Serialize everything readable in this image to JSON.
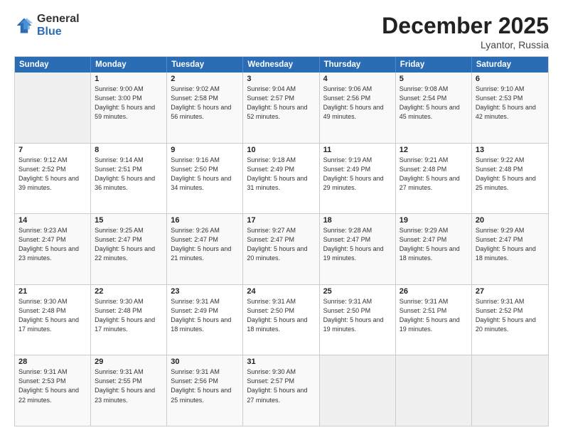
{
  "logo": {
    "general": "General",
    "blue": "Blue"
  },
  "title": {
    "month": "December 2025",
    "location": "Lyantor, Russia"
  },
  "header": {
    "days": [
      "Sunday",
      "Monday",
      "Tuesday",
      "Wednesday",
      "Thursday",
      "Friday",
      "Saturday"
    ]
  },
  "weeks": [
    [
      {
        "day": "",
        "sunrise": "",
        "sunset": "",
        "daylight": ""
      },
      {
        "day": "1",
        "sunrise": "Sunrise: 9:00 AM",
        "sunset": "Sunset: 3:00 PM",
        "daylight": "Daylight: 5 hours and 59 minutes."
      },
      {
        "day": "2",
        "sunrise": "Sunrise: 9:02 AM",
        "sunset": "Sunset: 2:58 PM",
        "daylight": "Daylight: 5 hours and 56 minutes."
      },
      {
        "day": "3",
        "sunrise": "Sunrise: 9:04 AM",
        "sunset": "Sunset: 2:57 PM",
        "daylight": "Daylight: 5 hours and 52 minutes."
      },
      {
        "day": "4",
        "sunrise": "Sunrise: 9:06 AM",
        "sunset": "Sunset: 2:56 PM",
        "daylight": "Daylight: 5 hours and 49 minutes."
      },
      {
        "day": "5",
        "sunrise": "Sunrise: 9:08 AM",
        "sunset": "Sunset: 2:54 PM",
        "daylight": "Daylight: 5 hours and 45 minutes."
      },
      {
        "day": "6",
        "sunrise": "Sunrise: 9:10 AM",
        "sunset": "Sunset: 2:53 PM",
        "daylight": "Daylight: 5 hours and 42 minutes."
      }
    ],
    [
      {
        "day": "7",
        "sunrise": "Sunrise: 9:12 AM",
        "sunset": "Sunset: 2:52 PM",
        "daylight": "Daylight: 5 hours and 39 minutes."
      },
      {
        "day": "8",
        "sunrise": "Sunrise: 9:14 AM",
        "sunset": "Sunset: 2:51 PM",
        "daylight": "Daylight: 5 hours and 36 minutes."
      },
      {
        "day": "9",
        "sunrise": "Sunrise: 9:16 AM",
        "sunset": "Sunset: 2:50 PM",
        "daylight": "Daylight: 5 hours and 34 minutes."
      },
      {
        "day": "10",
        "sunrise": "Sunrise: 9:18 AM",
        "sunset": "Sunset: 2:49 PM",
        "daylight": "Daylight: 5 hours and 31 minutes."
      },
      {
        "day": "11",
        "sunrise": "Sunrise: 9:19 AM",
        "sunset": "Sunset: 2:49 PM",
        "daylight": "Daylight: 5 hours and 29 minutes."
      },
      {
        "day": "12",
        "sunrise": "Sunrise: 9:21 AM",
        "sunset": "Sunset: 2:48 PM",
        "daylight": "Daylight: 5 hours and 27 minutes."
      },
      {
        "day": "13",
        "sunrise": "Sunrise: 9:22 AM",
        "sunset": "Sunset: 2:48 PM",
        "daylight": "Daylight: 5 hours and 25 minutes."
      }
    ],
    [
      {
        "day": "14",
        "sunrise": "Sunrise: 9:23 AM",
        "sunset": "Sunset: 2:47 PM",
        "daylight": "Daylight: 5 hours and 23 minutes."
      },
      {
        "day": "15",
        "sunrise": "Sunrise: 9:25 AM",
        "sunset": "Sunset: 2:47 PM",
        "daylight": "Daylight: 5 hours and 22 minutes."
      },
      {
        "day": "16",
        "sunrise": "Sunrise: 9:26 AM",
        "sunset": "Sunset: 2:47 PM",
        "daylight": "Daylight: 5 hours and 21 minutes."
      },
      {
        "day": "17",
        "sunrise": "Sunrise: 9:27 AM",
        "sunset": "Sunset: 2:47 PM",
        "daylight": "Daylight: 5 hours and 20 minutes."
      },
      {
        "day": "18",
        "sunrise": "Sunrise: 9:28 AM",
        "sunset": "Sunset: 2:47 PM",
        "daylight": "Daylight: 5 hours and 19 minutes."
      },
      {
        "day": "19",
        "sunrise": "Sunrise: 9:29 AM",
        "sunset": "Sunset: 2:47 PM",
        "daylight": "Daylight: 5 hours and 18 minutes."
      },
      {
        "day": "20",
        "sunrise": "Sunrise: 9:29 AM",
        "sunset": "Sunset: 2:47 PM",
        "daylight": "Daylight: 5 hours and 18 minutes."
      }
    ],
    [
      {
        "day": "21",
        "sunrise": "Sunrise: 9:30 AM",
        "sunset": "Sunset: 2:48 PM",
        "daylight": "Daylight: 5 hours and 17 minutes."
      },
      {
        "day": "22",
        "sunrise": "Sunrise: 9:30 AM",
        "sunset": "Sunset: 2:48 PM",
        "daylight": "Daylight: 5 hours and 17 minutes."
      },
      {
        "day": "23",
        "sunrise": "Sunrise: 9:31 AM",
        "sunset": "Sunset: 2:49 PM",
        "daylight": "Daylight: 5 hours and 18 minutes."
      },
      {
        "day": "24",
        "sunrise": "Sunrise: 9:31 AM",
        "sunset": "Sunset: 2:50 PM",
        "daylight": "Daylight: 5 hours and 18 minutes."
      },
      {
        "day": "25",
        "sunrise": "Sunrise: 9:31 AM",
        "sunset": "Sunset: 2:50 PM",
        "daylight": "Daylight: 5 hours and 19 minutes."
      },
      {
        "day": "26",
        "sunrise": "Sunrise: 9:31 AM",
        "sunset": "Sunset: 2:51 PM",
        "daylight": "Daylight: 5 hours and 19 minutes."
      },
      {
        "day": "27",
        "sunrise": "Sunrise: 9:31 AM",
        "sunset": "Sunset: 2:52 PM",
        "daylight": "Daylight: 5 hours and 20 minutes."
      }
    ],
    [
      {
        "day": "28",
        "sunrise": "Sunrise: 9:31 AM",
        "sunset": "Sunset: 2:53 PM",
        "daylight": "Daylight: 5 hours and 22 minutes."
      },
      {
        "day": "29",
        "sunrise": "Sunrise: 9:31 AM",
        "sunset": "Sunset: 2:55 PM",
        "daylight": "Daylight: 5 hours and 23 minutes."
      },
      {
        "day": "30",
        "sunrise": "Sunrise: 9:31 AM",
        "sunset": "Sunset: 2:56 PM",
        "daylight": "Daylight: 5 hours and 25 minutes."
      },
      {
        "day": "31",
        "sunrise": "Sunrise: 9:30 AM",
        "sunset": "Sunset: 2:57 PM",
        "daylight": "Daylight: 5 hours and 27 minutes."
      },
      {
        "day": "",
        "sunrise": "",
        "sunset": "",
        "daylight": ""
      },
      {
        "day": "",
        "sunrise": "",
        "sunset": "",
        "daylight": ""
      },
      {
        "day": "",
        "sunrise": "",
        "sunset": "",
        "daylight": ""
      }
    ]
  ]
}
